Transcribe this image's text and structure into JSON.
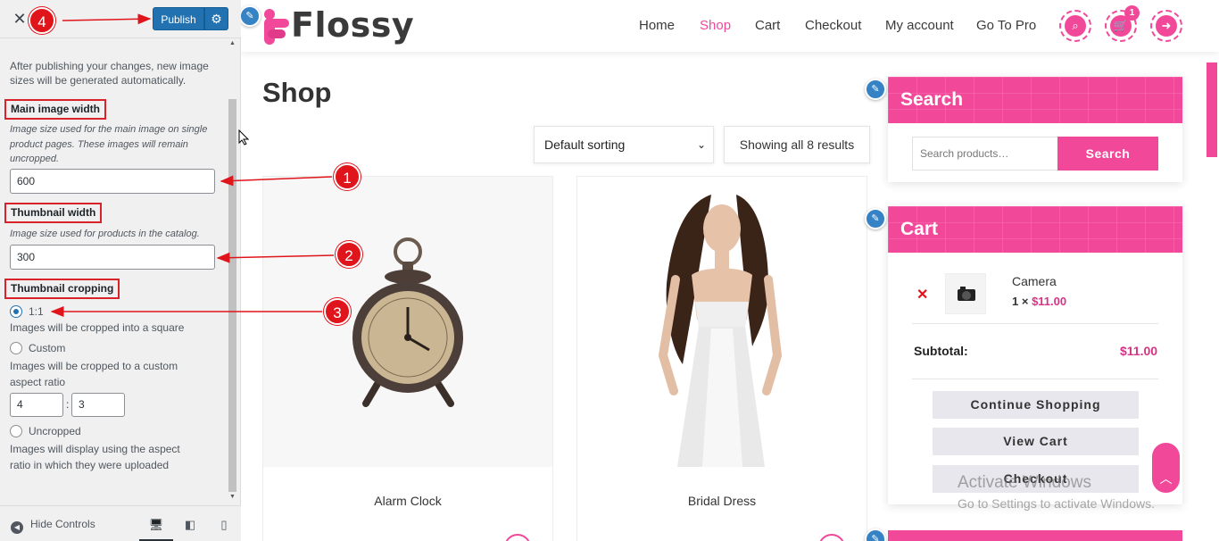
{
  "sidebar": {
    "header": {
      "publish_label": "Publish"
    },
    "intro_text": "After publishing your changes, new image sizes will be generated automatically.",
    "main_image": {
      "label": "Main image width",
      "description": "Image size used for the main image on single product pages. These images will remain uncropped.",
      "value": "600"
    },
    "thumbnail": {
      "label": "Thumbnail width",
      "description": "Image size used for products in the catalog.",
      "value": "300"
    },
    "cropping": {
      "label": "Thumbnail cropping",
      "selected": "1:1",
      "options": [
        {
          "label": "1:1",
          "description": "Images will be cropped into a square",
          "checked": true
        },
        {
          "label": "Custom",
          "description": "Images will be cropped to a custom aspect ratio",
          "checked": false
        },
        {
          "label": "Uncropped",
          "description": "Images will display using the aspect ratio in which they were uploaded",
          "checked": false
        }
      ],
      "ratio_width": "4",
      "ratio_separator": ":",
      "ratio_height": "3"
    },
    "footer": {
      "hide_controls": "Hide Controls"
    }
  },
  "markers": [
    "1",
    "2",
    "3",
    "4"
  ],
  "site": {
    "logo_text": "Flossy",
    "nav": [
      "Home",
      "Shop",
      "Cart",
      "Checkout",
      "My account",
      "Go To Pro"
    ],
    "active_nav": "Shop",
    "cart_count": "1",
    "accent_color": "#f2489a"
  },
  "shop": {
    "title": "Shop",
    "sorting": "Default sorting",
    "results": "Showing all 8 results",
    "products": [
      {
        "name": "Alarm Clock"
      },
      {
        "name": "Bridal Dress"
      }
    ]
  },
  "search_widget": {
    "title": "Search",
    "placeholder": "Search products…",
    "button": "Search"
  },
  "cart_widget": {
    "title": "Cart",
    "remove": "✕",
    "item_name": "Camera",
    "item_qty": "1 ×",
    "item_price": "$11.00",
    "subtotal_label": "Subtotal:",
    "subtotal_value": "$11.00",
    "buttons": [
      "Continue Shopping",
      "View Cart",
      "Checkout"
    ]
  },
  "watermark": {
    "title": "Activate Windows",
    "subtitle": "Go to Settings to activate Windows."
  }
}
